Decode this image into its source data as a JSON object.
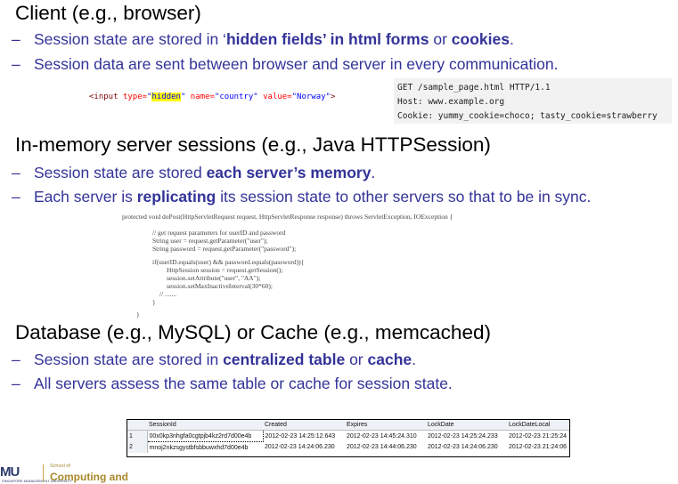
{
  "section1": {
    "heading": "Client (e.g., browser)",
    "bullet1": {
      "pre": "Session state are stored in ‘",
      "b1": "hidden fields’ in html forms",
      "mid": " or ",
      "b2": "cookies",
      "post": "."
    },
    "bullet2": {
      "text": "Session data are sent between browser and server in every communication."
    },
    "html_snippet": {
      "t1": "<input ",
      "a1": "type=",
      "v1q": "\"",
      "v1": "hidden",
      "v1q2": "\"",
      "a2": " name=",
      "v2": "\"country\"",
      "a3": " value=",
      "v3": "\"Norway\"",
      "t2": ">"
    },
    "http": {
      "line1": "GET /sample_page.html HTTP/1.1",
      "line2": "Host: www.example.org",
      "line3": "Cookie: yummy_cookie=choco; tasty_cookie=strawberry"
    }
  },
  "section2": {
    "heading": "In-memory server sessions (e.g., Java HTTPSession)",
    "bullet1": {
      "pre": "Session state are stored ",
      "b1": "each server’s memory",
      "post": "."
    },
    "bullet2": {
      "pre": "Each server is ",
      "b1": "replicating",
      "post": " its session state to other servers so that to be in sync."
    },
    "code": [
      "protected void doPost(HttpServletRequest request, HttpServletResponse response) throws ServletException, IOException {",
      "// get request parameters for userID and password",
      "String user = request.getParameter(\"user\");",
      "String password = request.getParameter(\"password\");",
      "if(userID.equals(user) && password.equals(password)){",
      "HttpSession session = request.getSession();",
      "session.setAttribute(\"user\", \"AA\");",
      "session.setMaxInactiveInterval(30*60);",
      "// .......",
      "}",
      "}"
    ]
  },
  "section3": {
    "heading": "Database (e.g., MySQL) or Cache (e.g., memcached)",
    "bullet1": {
      "pre": "Session state are stored in ",
      "b1": "centralized table",
      "mid": " or ",
      "b2": "cache",
      "post": "."
    },
    "bullet2": {
      "text": "All servers assess the same table or cache for session state."
    },
    "table": {
      "headers": [
        "SessionId",
        "Created",
        "Expires",
        "LockDate",
        "LockDateLocal"
      ],
      "rows": [
        {
          "n": "1",
          "cells": [
            "00x0kp3nhgfa0cgtpjb4kz2rd7d00e4b",
            "2012-02-23 14:25:12.643",
            "2012-02-23 14:45:24.310",
            "2012-02-23 14:25:24.233",
            "2012-02-23 21:25:24"
          ]
        },
        {
          "n": "2",
          "cells": [
            "mnoj2nkzsgystbfsbbuwxhd7d00e4b",
            "2012-02-23 14:24:06.230",
            "2012-02-23 14:44:06.230",
            "2012-02-23 14:24:06.230",
            "2012-02-23 21:24:06"
          ]
        }
      ]
    }
  },
  "logo": {
    "mark": "MU",
    "sub": "SINGAPORE MANAGEMENT UNIVERSITY",
    "school": "School of",
    "dept": "Computing and"
  }
}
